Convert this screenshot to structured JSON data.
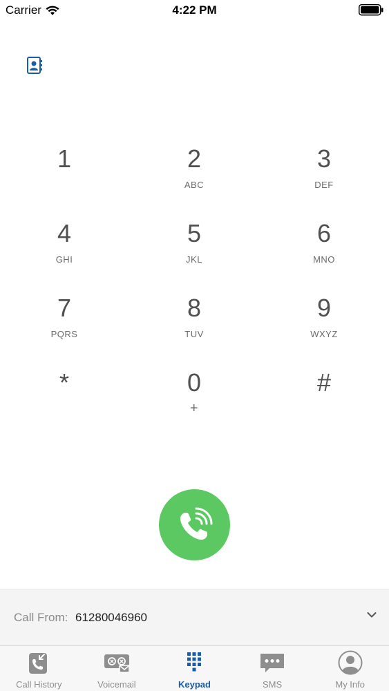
{
  "status_bar": {
    "carrier": "Carrier",
    "time": "4:22 PM"
  },
  "keypad": {
    "keys": [
      {
        "digit": "1",
        "letters": ""
      },
      {
        "digit": "2",
        "letters": "ABC"
      },
      {
        "digit": "3",
        "letters": "DEF"
      },
      {
        "digit": "4",
        "letters": "GHI"
      },
      {
        "digit": "5",
        "letters": "JKL"
      },
      {
        "digit": "6",
        "letters": "MNO"
      },
      {
        "digit": "7",
        "letters": "PQRS"
      },
      {
        "digit": "8",
        "letters": "TUV"
      },
      {
        "digit": "9",
        "letters": "WXYZ"
      },
      {
        "digit": "*",
        "letters": ""
      },
      {
        "digit": "0",
        "letters": "+"
      },
      {
        "digit": "#",
        "letters": ""
      }
    ]
  },
  "call_from": {
    "label": "Call From:",
    "number": "61280046960"
  },
  "tabs": [
    {
      "label": "Call History",
      "icon": "call-history-icon"
    },
    {
      "label": "Voicemail",
      "icon": "voicemail-icon"
    },
    {
      "label": "Keypad",
      "icon": "keypad-icon",
      "active": true
    },
    {
      "label": "SMS",
      "icon": "sms-icon"
    },
    {
      "label": "My Info",
      "icon": "my-info-icon"
    }
  ],
  "colors": {
    "call_button": "#5cc861",
    "accent": "#1a5ca8",
    "inactive_tab": "#8e8e8e"
  }
}
